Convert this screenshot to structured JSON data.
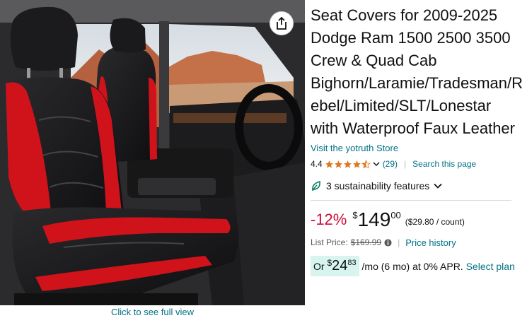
{
  "product": {
    "title": "Seat Covers for 2009-2025 Dodge Ram 1500 2500 3500 Crew & Quad Cab Bighorn/Laramie/Tradesman/Rebel/Limited/SLT/Lonestar with Waterproof Faux Leather",
    "store_link": "Visit the yotruth Store"
  },
  "image": {
    "full_view_label": "Click to see full view",
    "share_icon": "share-icon"
  },
  "rating": {
    "value": "4.4",
    "stars": 4.4,
    "count": "(29)",
    "search_link": "Search this page",
    "star_color": "#de7921"
  },
  "sustainability": {
    "label": "3 sustainability features"
  },
  "price": {
    "discount": "-12%",
    "symbol": "$",
    "whole": "149",
    "fraction": "00",
    "unit_price": "($29.80 / count)",
    "list_label": "List Price:",
    "list_price": "$169.99",
    "history_link": "Price history"
  },
  "financing": {
    "prefix": "Or ",
    "symbol": "$",
    "whole": "24",
    "fraction": "83",
    "suffix": "/mo (6 mo) at 0% APR. ",
    "select_link": "Select plan"
  },
  "colors": {
    "link": "#007185",
    "discount": "#cc0c39",
    "financing_bg": "#d7f5ee",
    "seat_red": "#d0131b"
  }
}
